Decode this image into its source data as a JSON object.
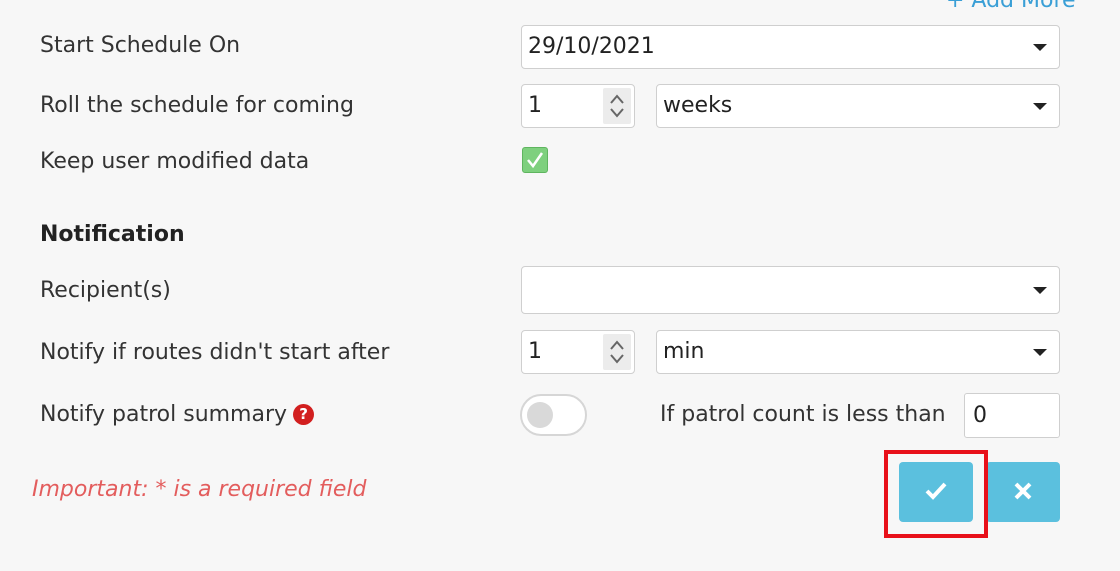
{
  "top": {
    "add_more": "+ Add More"
  },
  "schedule": {
    "start_label": "Start Schedule On",
    "start_value": "29/10/2021",
    "roll_label": "Roll the schedule for coming",
    "roll_count": "1",
    "roll_unit": "weeks",
    "keep_label": "Keep user modified data",
    "keep_checked": true
  },
  "notification": {
    "title": "Notification",
    "recipients_label": "Recipient(s)",
    "recipients_value": "",
    "routes_label": "Notify if routes didn't start after",
    "routes_count": "1",
    "routes_unit": "min",
    "summary_label": "Notify patrol summary",
    "summary_enabled": false,
    "patrol_less_label": "If patrol count is less than",
    "patrol_less_value": "0"
  },
  "footer": {
    "important_text": "Important: * is a required field"
  },
  "icons": {
    "help": "question-circle-icon",
    "confirm": "check-icon",
    "cancel": "times-icon"
  },
  "colors": {
    "accent_button": "#5bc0de",
    "checkbox_green": "#7ed07e",
    "help_red": "#d21f1f",
    "important_red": "#e35d5d",
    "highlight_red": "#e8101a",
    "link_blue": "#3a9fd6"
  }
}
